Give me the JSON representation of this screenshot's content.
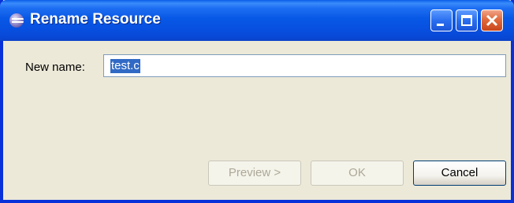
{
  "window": {
    "title": "Rename Resource",
    "title_icon": "eclipse-icon",
    "controls": [
      "minimize-icon",
      "maximize-icon",
      "close-icon"
    ]
  },
  "form": {
    "new_name_label": "New name:",
    "new_name_value": "test.c"
  },
  "buttons": {
    "preview": "Preview >",
    "ok": "OK",
    "cancel": "Cancel"
  },
  "colors": {
    "titlebar": "#0858e6",
    "selection": "#316ac5",
    "close": "#e06a3c"
  }
}
